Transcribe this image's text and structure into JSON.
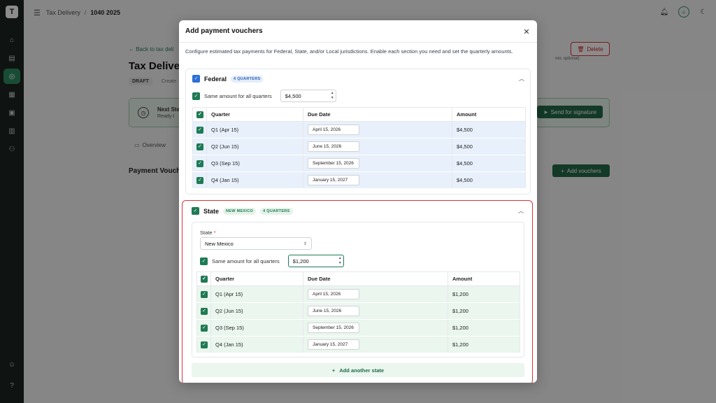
{
  "header": {
    "breadcrumb": [
      "Tax Delivery",
      "1040 2025"
    ],
    "separator": "/"
  },
  "background": {
    "back_link": "← Back to tax deli",
    "title": "Tax Delive",
    "draft_badge": "DRAFT",
    "created": "Create",
    "delete_label": "Delete",
    "owner_note": "ner, optional)",
    "next_step_title": "Next Ste",
    "next_step_sub": "Ready t",
    "send_signature_label": "Send for signature",
    "overview_tab": "Overview",
    "section_title": "Payment Vouch",
    "add_vouchers_label": "Add vouchers"
  },
  "modal": {
    "title": "Add payment vouchers",
    "description": "Configure estimated tax payments for Federal, State, and/or Local jurisdictions. Enable each section you need and set the quarterly amounts."
  },
  "federal": {
    "title": "Federal",
    "badge": "4 QUARTERS",
    "same_amount_label": "Same amount for all quarters",
    "amount": "$4,500",
    "columns": [
      "Quarter",
      "Due Date",
      "Amount"
    ],
    "rows": [
      {
        "quarter": "Q1 (Apr 15)",
        "due": "April 15, 2026",
        "amount": "$4,500"
      },
      {
        "quarter": "Q2 (Jun 15)",
        "due": "June 15, 2026",
        "amount": "$4,500"
      },
      {
        "quarter": "Q3 (Sep 15)",
        "due": "September 15, 2026",
        "amount": "$4,500"
      },
      {
        "quarter": "Q4 (Jan 15)",
        "due": "January 15, 2027",
        "amount": "$4,500"
      }
    ]
  },
  "state": {
    "title": "State",
    "badge_state": "NEW MEXICO",
    "badge_quarters": "4 QUARTERS",
    "state_label": "State",
    "required_mark": "*",
    "state_value": "New Mexico",
    "same_amount_label": "Same amount for all quarters",
    "amount": "$1,200",
    "columns": [
      "Quarter",
      "Due Date",
      "Amount"
    ],
    "rows": [
      {
        "quarter": "Q1 (Apr 15)",
        "due": "April 15, 2026",
        "amount": "$1,200"
      },
      {
        "quarter": "Q2 (Jun 15)",
        "due": "June 15, 2026",
        "amount": "$1,200"
      },
      {
        "quarter": "Q3 (Sep 15)",
        "due": "September 15, 2026",
        "amount": "$1,200"
      },
      {
        "quarter": "Q4 (Jan 15)",
        "due": "January 15, 2027",
        "amount": "$1,200"
      }
    ],
    "add_state_label": "Add another state"
  },
  "colors": {
    "accent_green": "#1f7a55",
    "federal_blue": "#2b6fd6",
    "highlight_red": "#d9343a"
  }
}
